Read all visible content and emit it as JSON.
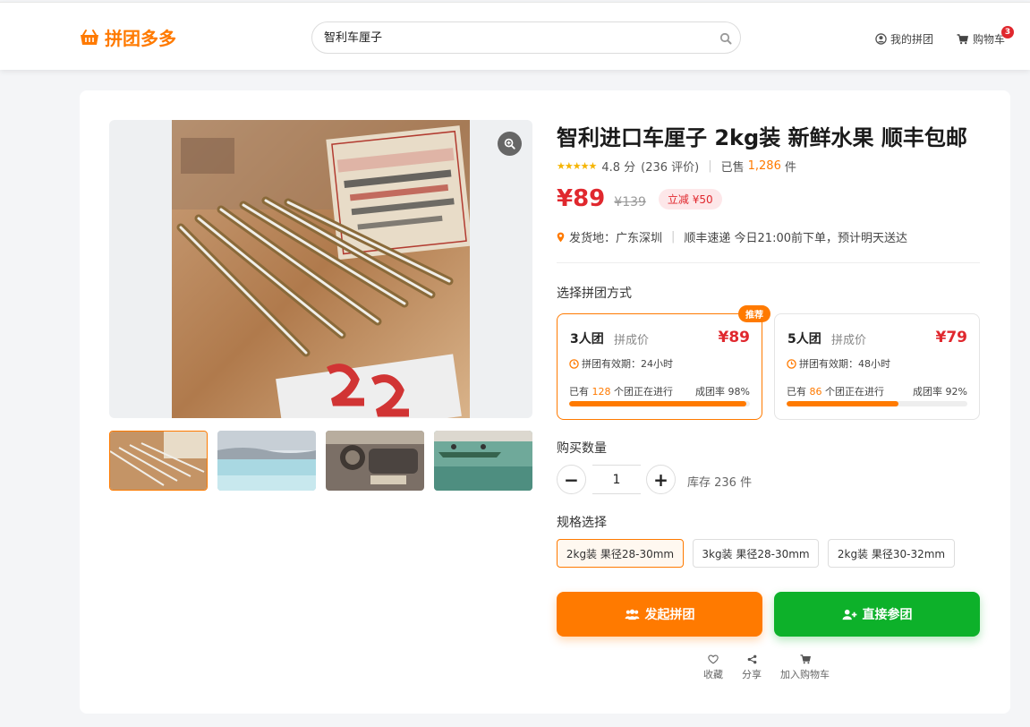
{
  "header": {
    "logo": "拼团多多",
    "search_value": "智利车厘子",
    "my_groups": "我的拼团",
    "cart": "购物车",
    "cart_count": "3"
  },
  "product": {
    "title": "智利进口车厘子 2kg装 新鲜水果 顺丰包邮",
    "rating_score": "4.8 分",
    "rating_count": "(236 评价)",
    "sold_prefix": "已售",
    "sold_count": "1,286",
    "sold_unit": "件",
    "price": "¥89",
    "original_price": "¥139",
    "discount": "立减 ¥50",
    "ship_from": "发货地：广东深圳",
    "ship_info": "顺丰速递 今日21:00前下单，预计明天送达"
  },
  "group_section": {
    "label": "选择拼团方式",
    "options": [
      {
        "badge": "推荐",
        "name": "3人团",
        "sub": "拼成价",
        "price": "¥89",
        "valid": "拼团有效期：24小时",
        "ongoing_prefix": "已有",
        "ongoing_count": "128",
        "ongoing_suffix": "个团正在进行",
        "rate": "成团率 98%",
        "rate_value": 0.98
      },
      {
        "name": "5人团",
        "sub": "拼成价",
        "price": "¥79",
        "valid": "拼团有效期：48小时",
        "ongoing_prefix": "已有",
        "ongoing_count": "86",
        "ongoing_suffix": "个团正在进行",
        "rate": "成团率 92%",
        "rate_value": 0.62
      }
    ]
  },
  "quantity": {
    "label": "购买数量",
    "minus": "−",
    "plus": "+",
    "value": "1",
    "stock": "库存 236 件"
  },
  "specs": {
    "label": "规格选择",
    "options": [
      "2kg装 果径28-30mm",
      "3kg装 果径28-30mm",
      "2kg装 果径30-32mm"
    ]
  },
  "buttons": {
    "start_group": "发起拼团",
    "join_group": "直接参团"
  },
  "actions": {
    "favorite": "收藏",
    "share": "分享",
    "add_cart": "加入购物车"
  },
  "colors": {
    "accent": "#ff7a00",
    "price_red": "#e0282e",
    "join_green": "#0db12a"
  },
  "icons": [
    "basket-icon",
    "search-icon",
    "user-circle-icon",
    "cart-icon",
    "zoom-icon",
    "location-pin-icon",
    "clock-icon",
    "users-icon",
    "user-plus-icon",
    "heart-icon",
    "share-icon"
  ]
}
